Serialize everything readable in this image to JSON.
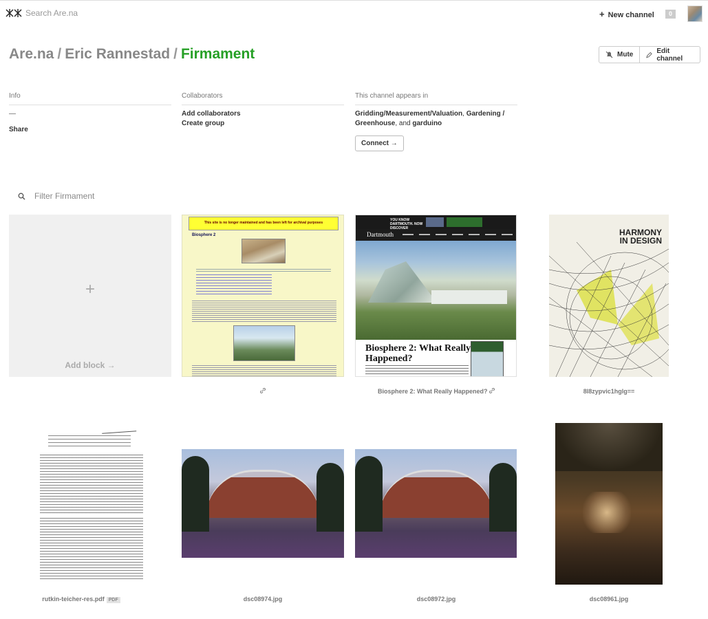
{
  "topbar": {
    "search_placeholder": "Search Are.na",
    "new_channel_label": "New channel",
    "notification_count": "0"
  },
  "breadcrumb": {
    "root": "Are.na",
    "user": "Eric Rannestad",
    "channel": "Firmament",
    "separator": "/"
  },
  "actions": {
    "mute_label": "Mute",
    "edit_label": "Edit channel"
  },
  "info": {
    "heading": "Info",
    "description": "—",
    "share_label": "Share"
  },
  "collaborators": {
    "heading": "Collaborators",
    "add_label": "Add collaborators",
    "create_group_label": "Create group"
  },
  "appears_in": {
    "heading": "This channel appears in",
    "channels": [
      "Gridding/Measurement/Valuation",
      "Gardening / Greenhouse",
      "garduino"
    ],
    "and_text": ", and",
    "connect_label": "Connect →"
  },
  "filter": {
    "placeholder": "Filter Firmament"
  },
  "add_block": {
    "plus": "+",
    "label": "Add block →"
  },
  "blocks": [
    {
      "caption": "",
      "link": true
    },
    {
      "caption": "Biosphere 2: What Really Happened?",
      "link": true
    },
    {
      "caption": "8l8zypvic1hglg==",
      "link": false
    },
    {
      "caption": "rutkin-teicher-res.pdf",
      "tag": "PDF"
    },
    {
      "caption": "dsc08974.jpg"
    },
    {
      "caption": "dsc08972.jpg"
    },
    {
      "caption": "dsc08961.jpg"
    }
  ],
  "thumb_text": {
    "b2_banner": "This site is no longer maintained and has been left for archival purposes",
    "b2_heading": "Biosphere 2",
    "dartmouth_brand": "Dartmouth",
    "dartmouth_headline": "Biosphere 2: What Really Happened?",
    "dartmouth_promo": "YOU KNOW DARTMOUTH. NOW DISCOVER",
    "harmony_title": "HARMONY IN DESIGN"
  },
  "colors": {
    "accent": "#26a026",
    "text": "#333333",
    "muted": "#888888"
  }
}
